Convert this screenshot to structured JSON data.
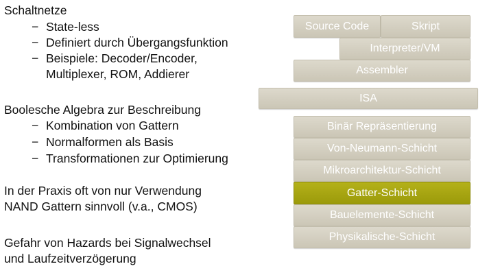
{
  "left": {
    "heading1": "Schaltnetze",
    "bullets1": [
      "State-less",
      "Definiert durch Übergangsfunktion",
      "Beispiele: Decoder/Encoder,"
    ],
    "bullets1_cont": "Multiplexer, ROM, Addierer",
    "heading2": "Boolesche Algebra zur Beschreibung",
    "bullets2": [
      "Kombination von Gattern",
      "Normalformen als Basis",
      "Transformationen zur Optimierung"
    ],
    "para3": [
      "In der Praxis oft von nur Verwendung",
      "NAND Gattern sinnvoll (v.a., CMOS)"
    ],
    "para4": [
      "Gefahr von Hazards bei Signalwechsel",
      "und Laufzeitverzögerung"
    ],
    "dash": "−"
  },
  "stack": {
    "source_code": "Source Code",
    "skript": "Skript",
    "interpreter": "Interpreter/VM",
    "assembler": "Assembler",
    "isa": "ISA",
    "layers": [
      "Binär Repräsentierung",
      "Von-Neumann-Schicht",
      "Mikroarchitektur-Schicht",
      "Gatter-Schicht",
      "Bauelemente-Schicht",
      "Physikalische-Schicht"
    ],
    "highlight_color": "#a8a610"
  }
}
